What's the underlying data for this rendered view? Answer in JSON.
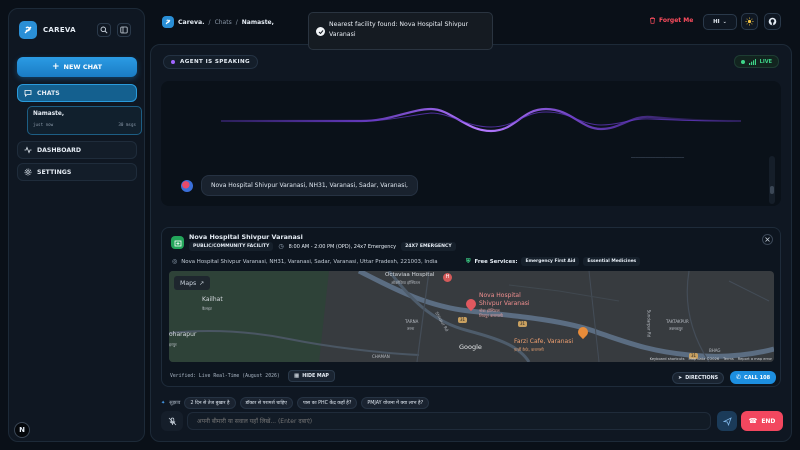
{
  "sidebar": {
    "brand": "CAREVA",
    "new_chat": "NEW CHAT",
    "chats_label": "CHATS",
    "chat_item": {
      "title": "Namaste,",
      "time": "just now",
      "count": "30 msgs"
    },
    "dashboard_label": "DASHBOARD",
    "settings_label": "SETTINGS",
    "footer_badge": "N"
  },
  "header": {
    "brand": "Careva.",
    "crumb_chats": "Chats",
    "crumb_current": "Namaste,",
    "forget_me": "Forget Me",
    "language": "HI"
  },
  "toast": {
    "message": "Nearest facility found: Nova Hospital Shivpur Varanasi"
  },
  "voice": {
    "status": "AGENT IS SPEAKING",
    "live": "LIVE",
    "agent_message": "Nova Hospital Shivpur Varanasi, NH31, Varanasi, Sadar, Varanasi,"
  },
  "facility": {
    "name": "Nova Hospital Shivpur Varanasi",
    "type": "PUBLIC/COMMUNITY FACILITY",
    "hours": "8:00 AM - 2:00 PM (OPD), 24x7 Emergency",
    "emergency_tag": "24X7 EMERGENCY",
    "address": "Nova Hospital Shivpur Varanasi, NH31, Varanasi, Sadar, Varanasi, Uttar Pradesh, 221003, India",
    "free_services_label": "Free Services:",
    "services": [
      "Emergency First Aid",
      "Essential Medicines"
    ],
    "verified": "Verified: Live Real-Time (August 2026)",
    "hide_map": "HIDE MAP",
    "directions": "DIRECTIONS",
    "call": "CALL 108"
  },
  "map": {
    "maps_button": "Maps",
    "labels": {
      "kailhat": "Kailhat",
      "kailhat_hi": "कैलहट",
      "dharapur": "oharapur",
      "dharapur_hi": "हरपुर",
      "octavias": "Octaviaa Hospital",
      "octavias_hi": "ऑक्टेविया हॉस्पिटल",
      "nova": "Nova Hospital",
      "nova2": "Shivpur Varanasi",
      "nova_hi": "नोवा हॉस्पिटल",
      "nova_hi2": "शिवपुर वाराणसी",
      "tarna": "TARNA",
      "tarna_hi": "तरना",
      "shivpur": "Shivpur Rd",
      "farzi": "Farzi Cafe, Varanasi",
      "farzi_hi": "फ़र्ज़ी कैफ़े, वाराणसी",
      "taktakpur": "TAKTAKPUR",
      "taktakpur_hi": "तक्तकपुर",
      "sundarpur": "Sundarpur Rd",
      "google": "Google",
      "road1": "31",
      "road2": "31",
      "road3": "31",
      "shanti": "CHAMAN",
      "bhag": "BHAG"
    },
    "attribution": [
      "Keyboard shortcuts",
      "Map data ©2026",
      "Terms",
      "Report a map error"
    ]
  },
  "suggestions": {
    "label": "सुझाव",
    "items": [
      "2 दिन से तेज बुखार है",
      "डॉक्टर से परामर्श चाहिए",
      "पास का PHC केंद्र कहाँ है?",
      "PMJAY योजना में क्या लाभ है?"
    ]
  },
  "input": {
    "placeholder": "अपनी बीमारी या सवाल यहाँ लिखें... (Enter दबाएं)",
    "end_label": "END"
  },
  "colors": {
    "accent": "#2a8fd6",
    "live": "#3ed68a",
    "danger": "#f2475f",
    "wave": "#8a4bff"
  }
}
